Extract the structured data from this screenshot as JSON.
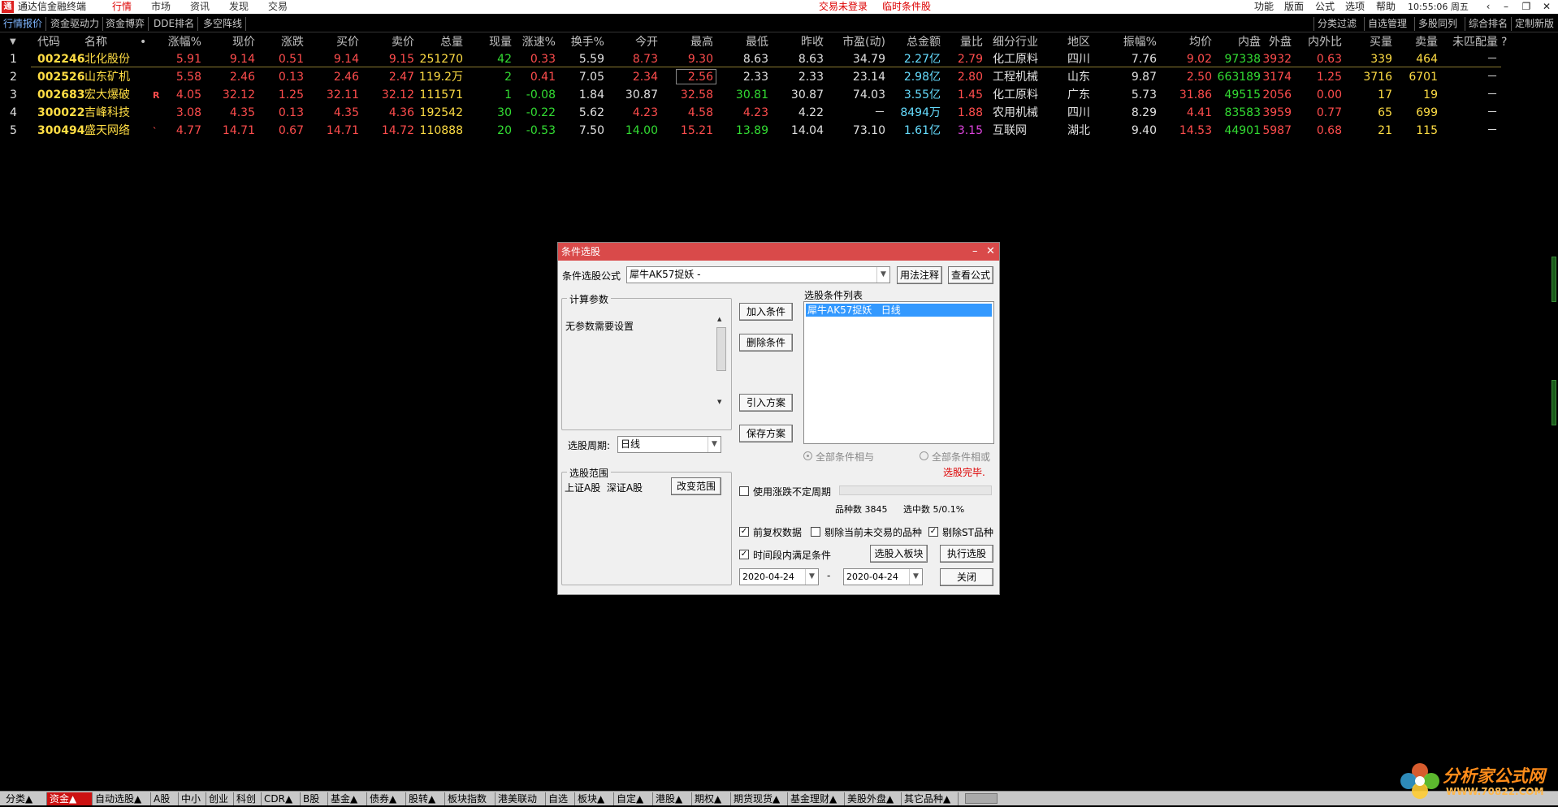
{
  "titlebar": {
    "app_title": "通达信金融终端",
    "menus": [
      "行情",
      "市场",
      "资讯",
      "发现",
      "交易"
    ],
    "active_menu": "行情",
    "trade_status": "交易未登录",
    "temp_pick": "临时条件股",
    "right_menus": [
      "功能",
      "版面",
      "公式",
      "选项",
      "帮助"
    ],
    "clock": "10:55:06 周五"
  },
  "subbar": {
    "tabs": [
      "行情报价",
      "资金驱动力",
      "资金博弈",
      "DDE排名",
      "多空阵线"
    ],
    "right_tabs": [
      "分类过滤",
      "自选管理",
      "多股同列",
      "综合排名",
      "定制新版"
    ]
  },
  "table": {
    "headers": [
      "代码",
      "名称",
      "•",
      "涨幅%",
      "现价",
      "涨跌",
      "买价",
      "卖价",
      "总量",
      "现量",
      "涨速%",
      "换手%",
      "今开",
      "最高",
      "最低",
      "昨收",
      "市盈(动)",
      "总金额",
      "量比",
      "细分行业",
      "地区",
      "振幅%",
      "均价",
      "内盘",
      "外盘",
      "内外比",
      "买量",
      "卖量",
      "未匹配量",
      "?"
    ],
    "rows": [
      {
        "idx": "1",
        "code": "002246",
        "name": "北化股份",
        "mark": "",
        "pct": "5.91",
        "price": "9.14",
        "chg": "0.51",
        "bid": "9.14",
        "ask": "9.15",
        "vol": "251270",
        "cur": "42",
        "speed": "0.33",
        "turn": "5.59",
        "open": "8.73",
        "high": "9.30",
        "low": "8.63",
        "prev": "8.63",
        "pe": "34.79",
        "amt": "2.27亿",
        "vr": "2.79",
        "ind": "化工原料",
        "area": "四川",
        "amp": "7.76",
        "avg": "9.02",
        "inner": "97338",
        "outer": "3932",
        "ior": "0.63",
        "bvol": "339",
        "svol": "464",
        "unm": "－"
      },
      {
        "idx": "2",
        "code": "002526",
        "name": "山东矿机",
        "mark": "",
        "pct": "5.58",
        "price": "2.46",
        "chg": "0.13",
        "bid": "2.46",
        "ask": "2.47",
        "vol": "119.2万",
        "cur": "2",
        "speed": "0.41",
        "turn": "7.05",
        "open": "2.34",
        "high": "2.56",
        "low": "2.33",
        "prev": "2.33",
        "pe": "23.14",
        "amt": "2.98亿",
        "vr": "2.80",
        "ind": "工程机械",
        "area": "山东",
        "amp": "9.87",
        "avg": "2.50",
        "inner": "663189",
        "outer": "3174",
        "ior": "1.25",
        "bvol": "3716",
        "svol": "6701",
        "unm": "－"
      },
      {
        "idx": "3",
        "code": "002683",
        "name": "宏大爆破",
        "mark": "R",
        "pct": "4.05",
        "price": "32.12",
        "chg": "1.25",
        "bid": "32.11",
        "ask": "32.12",
        "vol": "111571",
        "cur": "1",
        "speed": "-0.08",
        "turn": "1.84",
        "open": "30.87",
        "high": "32.58",
        "low": "30.81",
        "prev": "30.87",
        "pe": "74.03",
        "amt": "3.55亿",
        "vr": "1.45",
        "ind": "化工原料",
        "area": "广东",
        "amp": "5.73",
        "avg": "31.86",
        "inner": "49515",
        "outer": "2056",
        "ior": "0.00",
        "bvol": "17",
        "svol": "19",
        "unm": "－"
      },
      {
        "idx": "4",
        "code": "300022",
        "name": "吉峰科技",
        "mark": "",
        "pct": "3.08",
        "price": "4.35",
        "chg": "0.13",
        "bid": "4.35",
        "ask": "4.36",
        "vol": "192542",
        "cur": "30",
        "speed": "-0.22",
        "turn": "5.62",
        "open": "4.23",
        "high": "4.58",
        "low": "4.23",
        "prev": "4.22",
        "pe": "－",
        "amt": "8494万",
        "vr": "1.88",
        "ind": "农用机械",
        "area": "四川",
        "amp": "8.29",
        "avg": "4.41",
        "inner": "83583",
        "outer": "3959",
        "ior": "0.77",
        "bvol": "65",
        "svol": "699",
        "unm": "－"
      },
      {
        "idx": "5",
        "code": "300494",
        "name": "盛天网络",
        "mark": "`",
        "pct": "4.77",
        "price": "14.71",
        "chg": "0.67",
        "bid": "14.71",
        "ask": "14.72",
        "vol": "110888",
        "cur": "20",
        "speed": "-0.53",
        "turn": "7.50",
        "open": "14.00",
        "high": "15.21",
        "low": "13.89",
        "prev": "14.04",
        "pe": "73.10",
        "amt": "1.61亿",
        "vr": "3.15",
        "ind": "互联网",
        "area": "湖北",
        "amp": "9.40",
        "avg": "14.53",
        "inner": "44901",
        "outer": "5987",
        "ior": "0.68",
        "bvol": "21",
        "svol": "115",
        "unm": "－"
      }
    ]
  },
  "dialog": {
    "title": "条件选股",
    "formula_label": "条件选股公式",
    "formula_value": "犀牛AK57捉妖 -",
    "usage_btn": "用法注释",
    "view_formula_btn": "查看公式",
    "params_group": "计算参数",
    "params_text": "无参数需要设置",
    "period_label": "选股周期:",
    "period_value": "日线",
    "add_btn": "加入条件",
    "del_btn": "删除条件",
    "import_btn": "引入方案",
    "save_btn": "保存方案",
    "list_label": "选股条件列表",
    "list_items": [
      "犀牛AK57捉妖   日线"
    ],
    "radio_and": "全部条件相与",
    "radio_or": "全部条件相或",
    "status": "选股完毕.",
    "range_group": "选股范围",
    "range_text": "上证A股  深证A股",
    "change_range_btn": "改变范围",
    "use_period_label": "使用涨跌不定周期",
    "count_label": "品种数 3845",
    "selected_label": "选中数 5/0.1%",
    "adj_label": "前复权数据",
    "excl_untraded_label": "剔除当前未交易的品种",
    "excl_st_label": "剔除ST品种",
    "timespan_label": "时间段内满足条件",
    "to_block_btn": "选股入板块",
    "exec_btn": "执行选股",
    "date_from": "2020-04-24",
    "date_sep": "-",
    "date_to": "2020-04-24",
    "close_btn": "关闭"
  },
  "bottombar": {
    "tabs": [
      "分类▲",
      "资金▲",
      "自动选股▲",
      "A股",
      "中小",
      "创业",
      "科创",
      "CDR▲",
      "B股",
      "基金▲",
      "债券▲",
      "股转▲",
      "板块指数",
      "港美联动",
      "自选",
      "板块▲",
      "自定▲",
      "港股▲",
      "期权▲",
      "期货现货▲",
      "基金理财▲",
      "美股外盘▲",
      "其它品种▲"
    ],
    "active": "资金▲"
  },
  "watermark": {
    "text": "分析家公式网",
    "url": "WWW.70822.COM"
  }
}
